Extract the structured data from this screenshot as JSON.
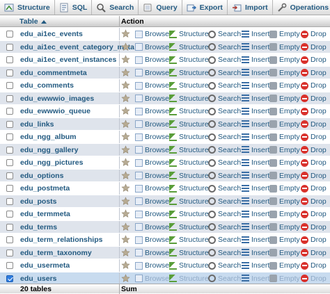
{
  "tabs": [
    {
      "label": "Structure",
      "icon": "structure-icon"
    },
    {
      "label": "SQL",
      "icon": "sql-icon"
    },
    {
      "label": "Search",
      "icon": "search-icon"
    },
    {
      "label": "Query",
      "icon": "query-icon"
    },
    {
      "label": "Export",
      "icon": "export-icon"
    },
    {
      "label": "Import",
      "icon": "import-icon"
    },
    {
      "label": "Operations",
      "icon": "wrench-icon"
    }
  ],
  "table_header": {
    "table": "Table",
    "action": "Action"
  },
  "actions": {
    "browse": "Browse",
    "structure": "Structure",
    "search": "Search",
    "insert": "Insert",
    "empty": "Empty",
    "drop": "Drop"
  },
  "rows": [
    {
      "name": "edu_ai1ec_events",
      "checked": false
    },
    {
      "name": "edu_ai1ec_event_category_meta",
      "checked": false
    },
    {
      "name": "edu_ai1ec_event_instances",
      "checked": false
    },
    {
      "name": "edu_commentmeta",
      "checked": false
    },
    {
      "name": "edu_comments",
      "checked": false
    },
    {
      "name": "edu_ewwwio_images",
      "checked": false
    },
    {
      "name": "edu_ewwwio_queue",
      "checked": false
    },
    {
      "name": "edu_links",
      "checked": false
    },
    {
      "name": "edu_ngg_album",
      "checked": false
    },
    {
      "name": "edu_ngg_gallery",
      "checked": false
    },
    {
      "name": "edu_ngg_pictures",
      "checked": false
    },
    {
      "name": "edu_options",
      "checked": false
    },
    {
      "name": "edu_postmeta",
      "checked": false
    },
    {
      "name": "edu_posts",
      "checked": false
    },
    {
      "name": "edu_termmeta",
      "checked": false
    },
    {
      "name": "edu_terms",
      "checked": false
    },
    {
      "name": "edu_term_relationships",
      "checked": false
    },
    {
      "name": "edu_term_taxonomy",
      "checked": false
    },
    {
      "name": "edu_usermeta",
      "checked": false
    },
    {
      "name": "edu_users",
      "checked": true
    }
  ],
  "footer": {
    "count": "20 tables",
    "sum": "Sum"
  },
  "colors": {
    "link": "#235a81",
    "row_alt": "#dfe4ec",
    "row_selected": "#c8dbef",
    "drop": "#d9322d"
  }
}
